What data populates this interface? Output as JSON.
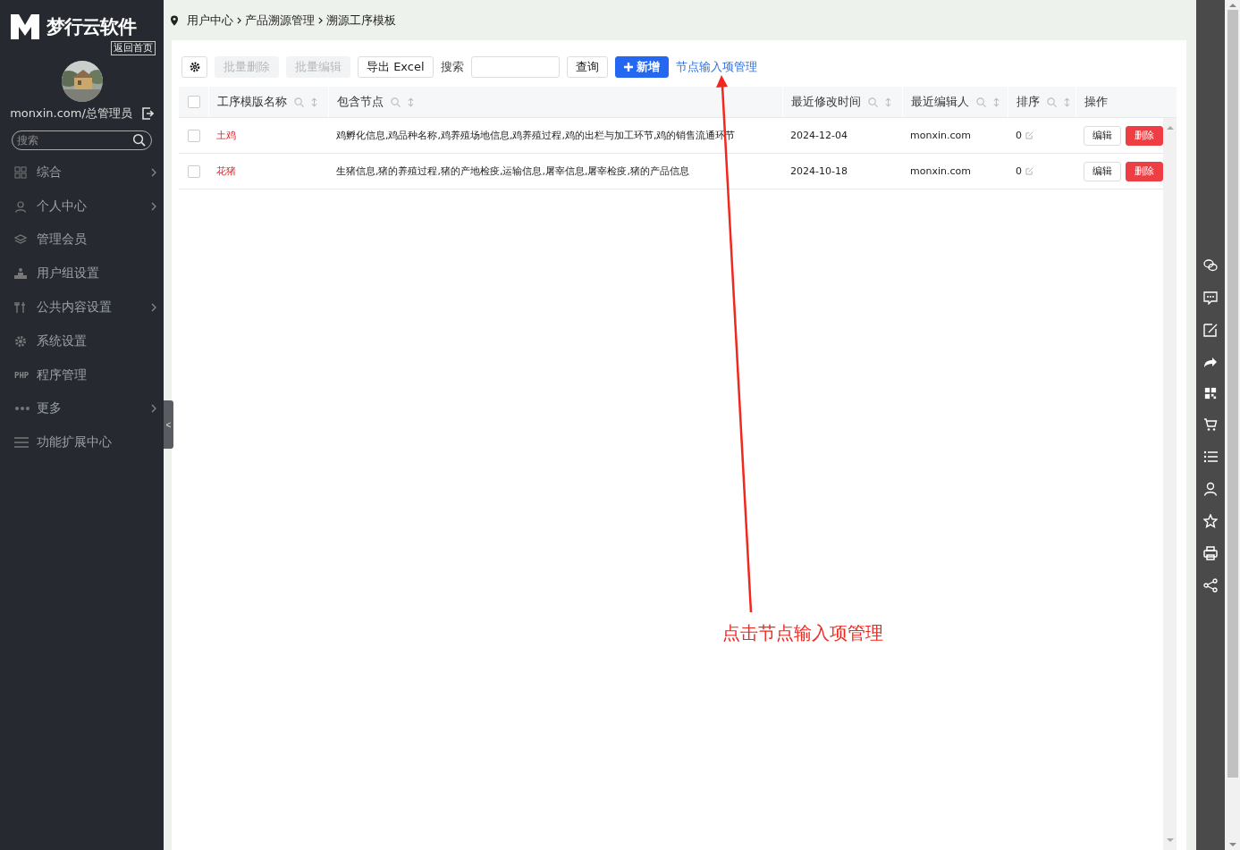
{
  "sidebar": {
    "logo_text": "梦行云软件",
    "back_home": "返回首页",
    "user": "monxin.com/总管理员",
    "search": {
      "placeholder": "搜索"
    },
    "items": [
      {
        "label": "综合",
        "kind": "grid",
        "has_submenu": true
      },
      {
        "label": "个人中心",
        "kind": "person",
        "has_submenu": true
      },
      {
        "label": "管理会员",
        "kind": "layers",
        "has_submenu": false
      },
      {
        "label": "用户组设置",
        "kind": "group",
        "has_submenu": false
      },
      {
        "label": "公共内容设置",
        "kind": "tools",
        "has_submenu": true
      },
      {
        "label": "系统设置",
        "kind": "gear",
        "has_submenu": false
      },
      {
        "label": "程序管理",
        "kind": "text",
        "icon_text": "PHP",
        "has_submenu": false
      },
      {
        "label": "更多",
        "kind": "dots",
        "has_submenu": true
      },
      {
        "label": "功能扩展中心",
        "kind": "lines",
        "has_submenu": false
      }
    ],
    "collapse": "<"
  },
  "breadcrumb": [
    "用户中心",
    "产品溯源管理",
    "溯源工序模板"
  ],
  "toolbar": {
    "batch_delete": {
      "label": "批量删除",
      "disabled": true
    },
    "batch_edit": {
      "label": "批量编辑",
      "disabled": true
    },
    "export": "导出 Excel",
    "search_label": "搜索",
    "query": "查询",
    "add": "新增",
    "link": "节点输入项管理"
  },
  "table": {
    "all_selected": false,
    "columns": [
      {
        "label": "工序模版名称",
        "searchable": true,
        "sortable": true
      },
      {
        "label": "包含节点",
        "searchable": true,
        "sortable": true
      },
      {
        "label": "最近修改时间",
        "searchable": true,
        "sortable": true
      },
      {
        "label": "最近编辑人",
        "searchable": true,
        "sortable": true
      },
      {
        "label": "排序",
        "searchable": true,
        "sortable": true
      },
      {
        "label": "操作",
        "searchable": false,
        "sortable": false
      }
    ],
    "rows": [
      {
        "selected": false,
        "name": "土鸡",
        "nodes": "鸡孵化信息,鸡品种名称,鸡养殖场地信息,鸡养殖过程,鸡的出栏与加工环节,鸡的销售流通环节",
        "modified": "2024-12-04",
        "editor": "monxin.com",
        "order": "0",
        "edit": "编辑",
        "delete": "删除"
      },
      {
        "selected": false,
        "name": "花猪",
        "nodes": "生猪信息,猪的养殖过程,猪的产地检疫,运输信息,屠宰信息,屠宰检疫,猪的产品信息",
        "modified": "2024-10-18",
        "editor": "monxin.com",
        "order": "0",
        "edit": "编辑",
        "delete": "删除"
      }
    ]
  },
  "annotation": "点击节点输入项管理"
}
